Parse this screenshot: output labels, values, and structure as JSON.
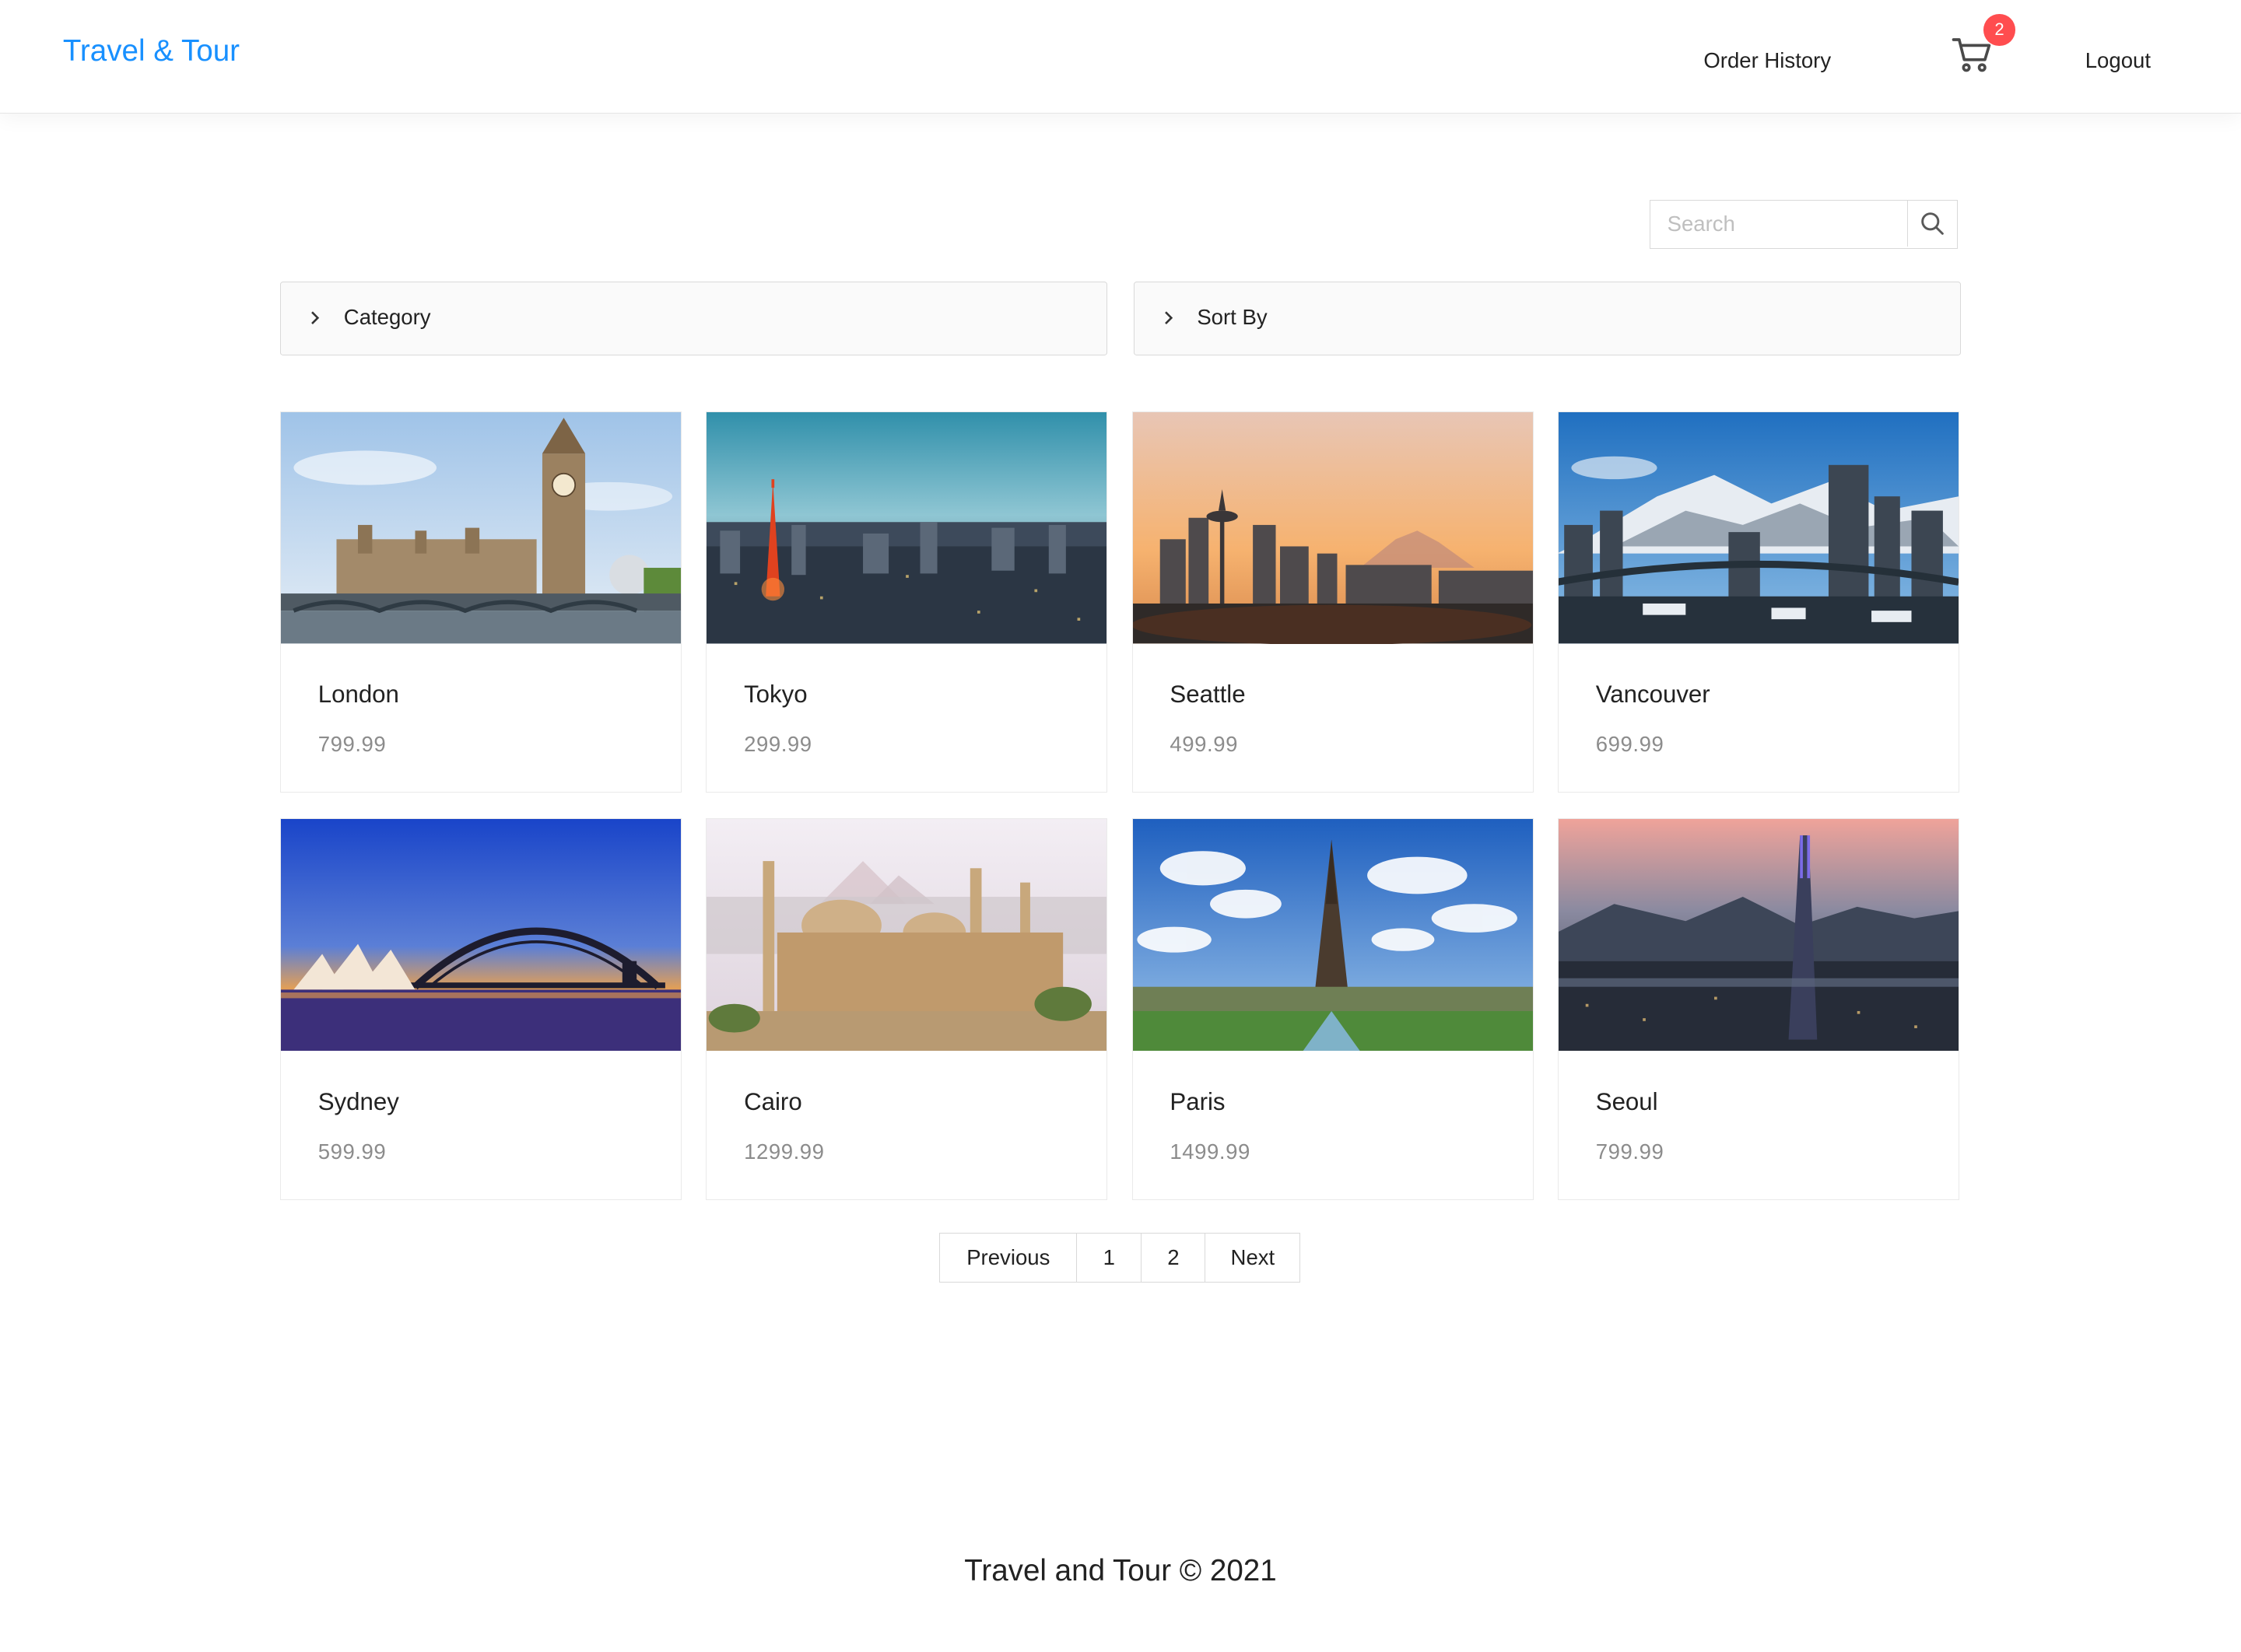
{
  "header": {
    "brand": "Travel & Tour",
    "nav": {
      "order_history": "Order History",
      "logout": "Logout"
    },
    "cart_count": "2"
  },
  "search": {
    "placeholder": "Search"
  },
  "filters": {
    "category_label": "Category",
    "sort_label": "Sort By"
  },
  "destinations": [
    {
      "name": "London",
      "price": "799.99"
    },
    {
      "name": "Tokyo",
      "price": "299.99"
    },
    {
      "name": "Seattle",
      "price": "499.99"
    },
    {
      "name": "Vancouver",
      "price": "699.99"
    },
    {
      "name": "Sydney",
      "price": "599.99"
    },
    {
      "name": "Cairo",
      "price": "1299.99"
    },
    {
      "name": "Paris",
      "price": "1499.99"
    },
    {
      "name": "Seoul",
      "price": "799.99"
    }
  ],
  "pagination": {
    "previous": "Previous",
    "pages": [
      "1",
      "2"
    ],
    "next": "Next"
  },
  "footer": {
    "text": "Travel and Tour © 2021"
  },
  "colors": {
    "brand": "#1890ff",
    "badge": "#ff4d4f",
    "price": "#8c8c8c"
  }
}
